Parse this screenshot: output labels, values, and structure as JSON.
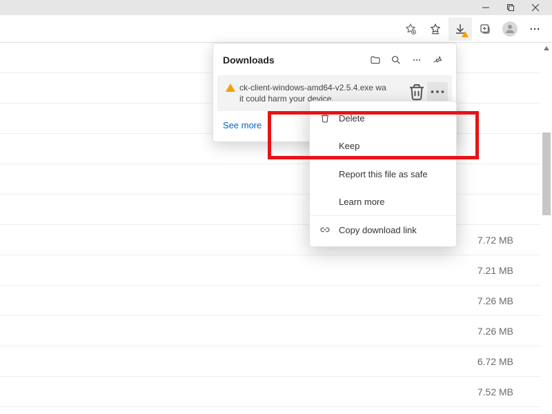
{
  "window": {
    "minimize": "—",
    "maximize": "❐",
    "close": "✕"
  },
  "downloads_panel": {
    "title": "Downloads",
    "item": {
      "line1": "ck-client-windows-amd64-v2.5.4.exe wa",
      "line2": "it could harm your device."
    },
    "see_more": "See more"
  },
  "context_menu": {
    "delete": "Delete",
    "keep": "Keep",
    "report": "Report this file as safe",
    "learn": "Learn more",
    "copy": "Copy download link"
  },
  "rows": [
    {
      "size": ""
    },
    {
      "size": ""
    },
    {
      "size": ""
    },
    {
      "size": ""
    },
    {
      "size": ""
    },
    {
      "size": ""
    },
    {
      "size": "7.72 MB"
    },
    {
      "size": "7.21 MB"
    },
    {
      "size": "7.26 MB"
    },
    {
      "size": "7.26 MB"
    },
    {
      "size": "6.72 MB"
    },
    {
      "size": "7.52 MB"
    }
  ]
}
